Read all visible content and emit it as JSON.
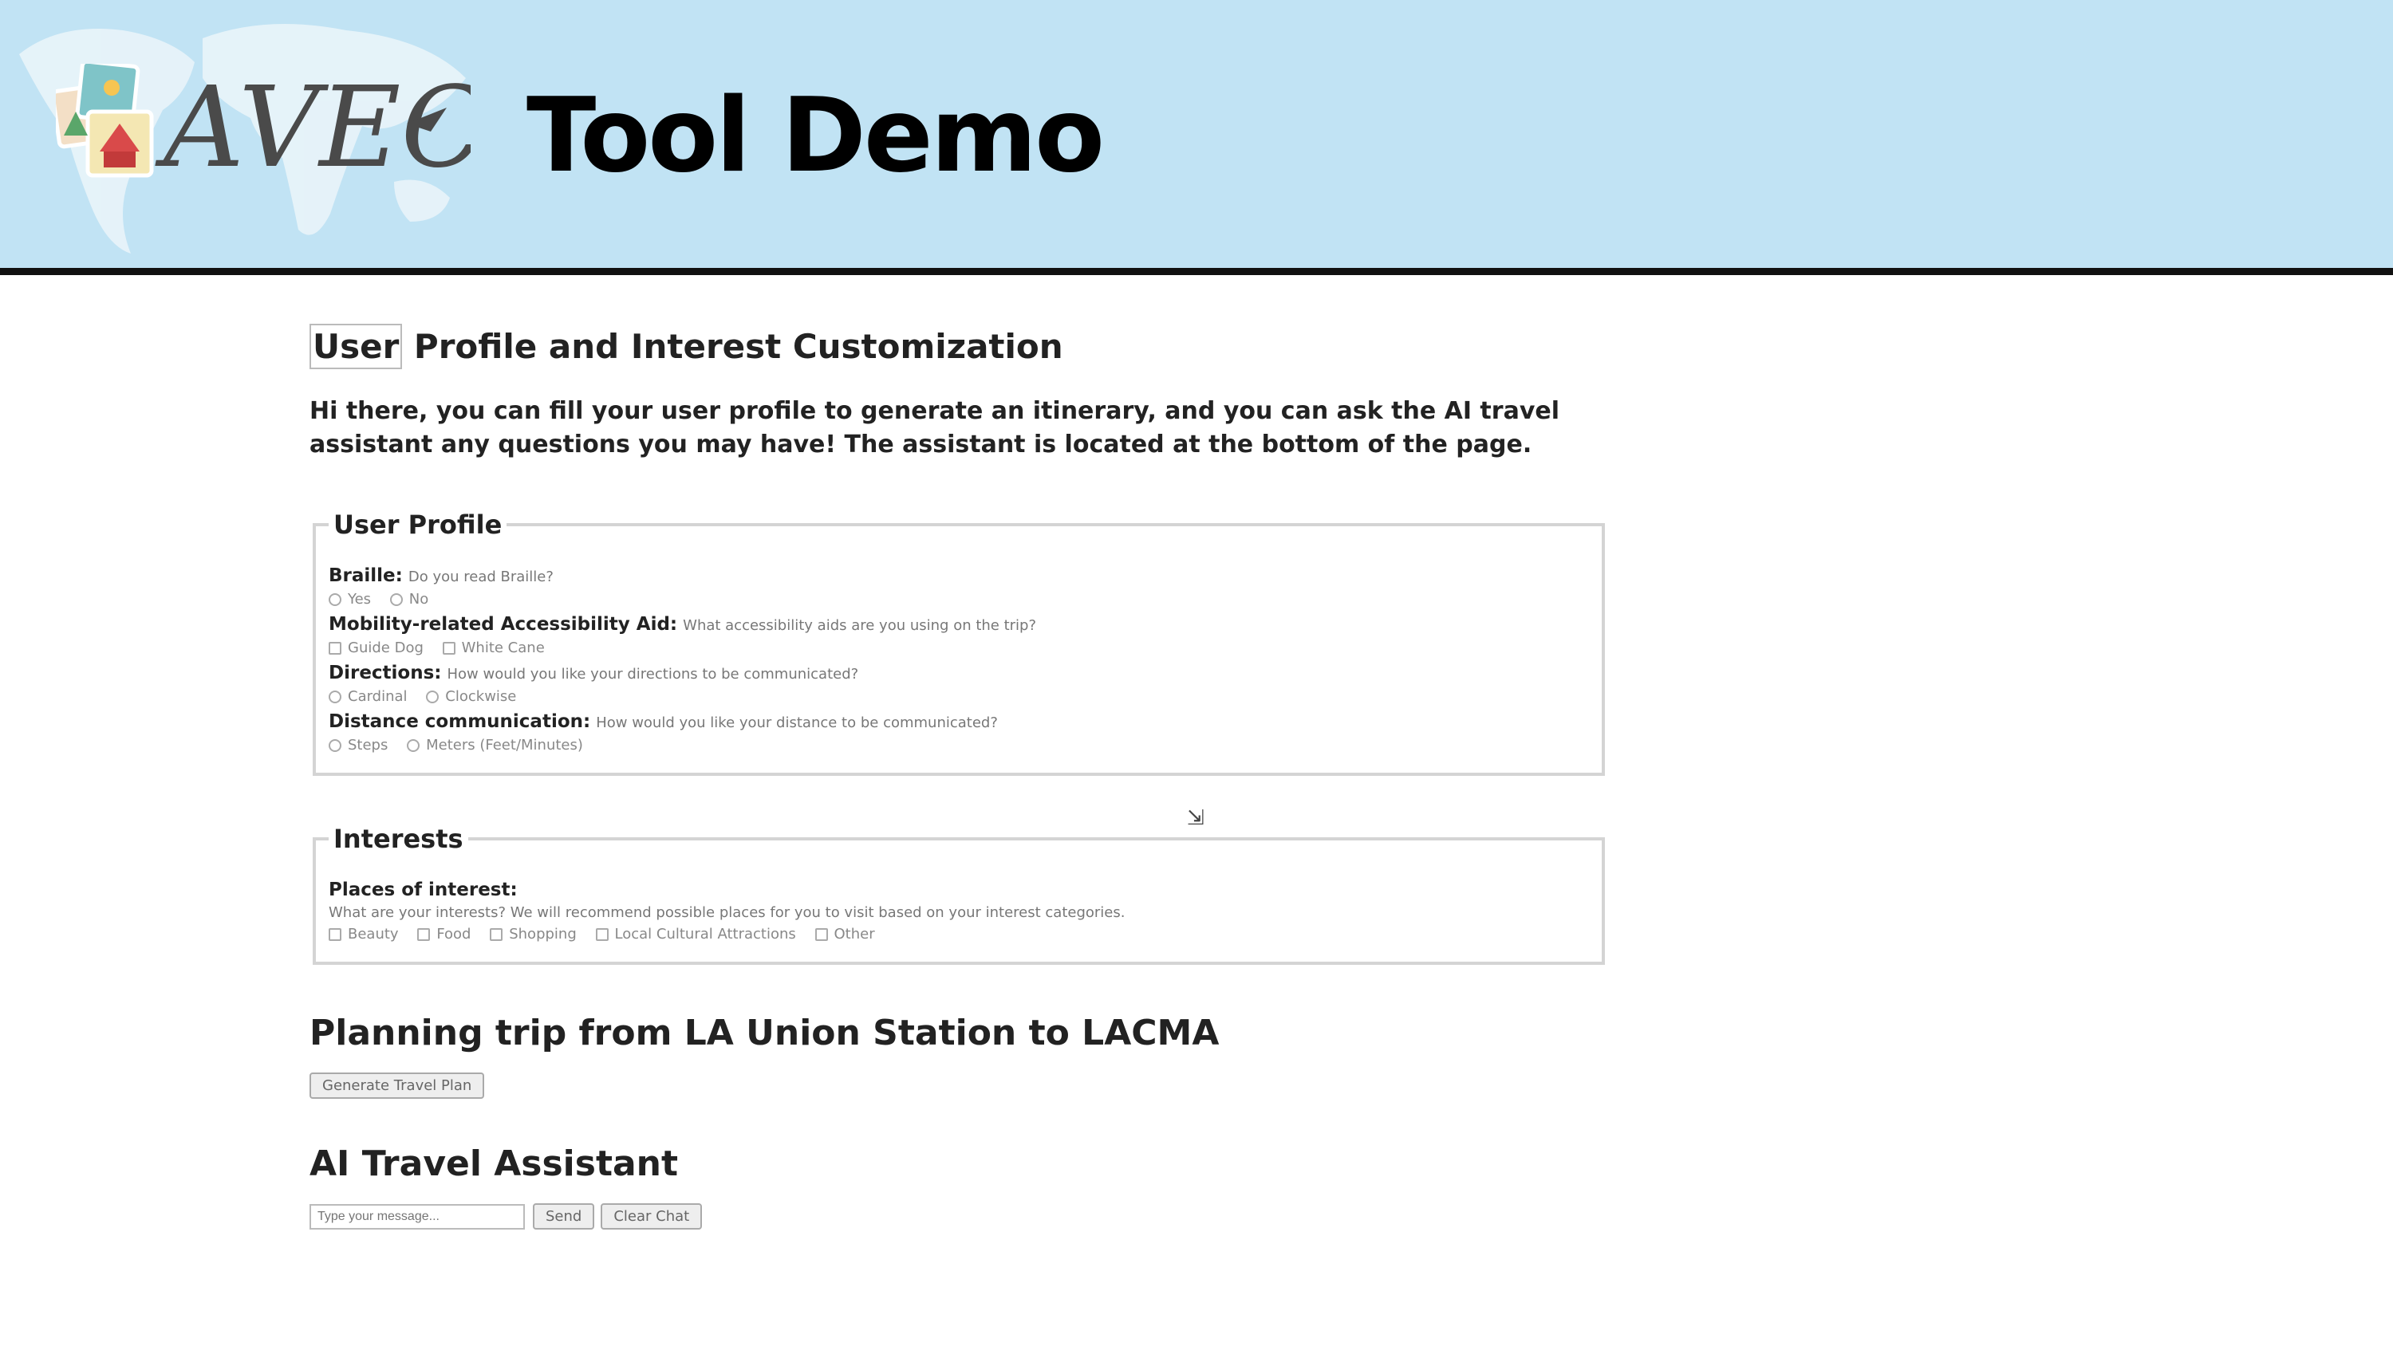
{
  "header": {
    "logo_text": "AVEC",
    "title": "Tool Demo",
    "colors": {
      "banner_bg": "#c1e3f4",
      "divider": "#111111"
    }
  },
  "profile_section": {
    "heading_first": "User",
    "heading_rest": " Profile and Interest Customization",
    "intro": "Hi there, you can fill your user profile to generate an itinerary, and you can ask the AI travel assistant any questions you may have! The assistant is located at the bottom of the page."
  },
  "user_profile": {
    "legend": "User Profile",
    "questions": [
      {
        "label": "Braille:",
        "prompt": "Do you read Braille?",
        "options": [
          "Yes",
          "No"
        ]
      },
      {
        "label": "Mobility-related Accessibility Aid:",
        "prompt": "What accessibility aids are you using on the trip?",
        "options": [
          "Guide Dog",
          "White Cane"
        ]
      },
      {
        "label": "Directions:",
        "prompt": "How would you like your directions to be communicated?",
        "options": [
          "Cardinal",
          "Clockwise"
        ]
      },
      {
        "label": "Distance communication:",
        "prompt": "How would you like your distance to be communicated?",
        "options": [
          "Steps",
          "Meters (Feet/Minutes)"
        ]
      }
    ]
  },
  "interests": {
    "legend": "Interests",
    "label": "Places of interest:",
    "prompt": "What are your interests? We will recommend possible places for you to visit based on your interest categories.",
    "options": [
      "Beauty",
      "Food",
      "Shopping",
      "Local Cultural Attractions",
      "Other"
    ]
  },
  "trip": {
    "heading": "Planning trip from LA Union Station to LACMA",
    "button": "Generate Travel Plan"
  },
  "assistant": {
    "heading": "AI Travel Assistant",
    "input_placeholder": "Type your message...",
    "send_button": "Send",
    "clear_button": "Clear Chat"
  }
}
